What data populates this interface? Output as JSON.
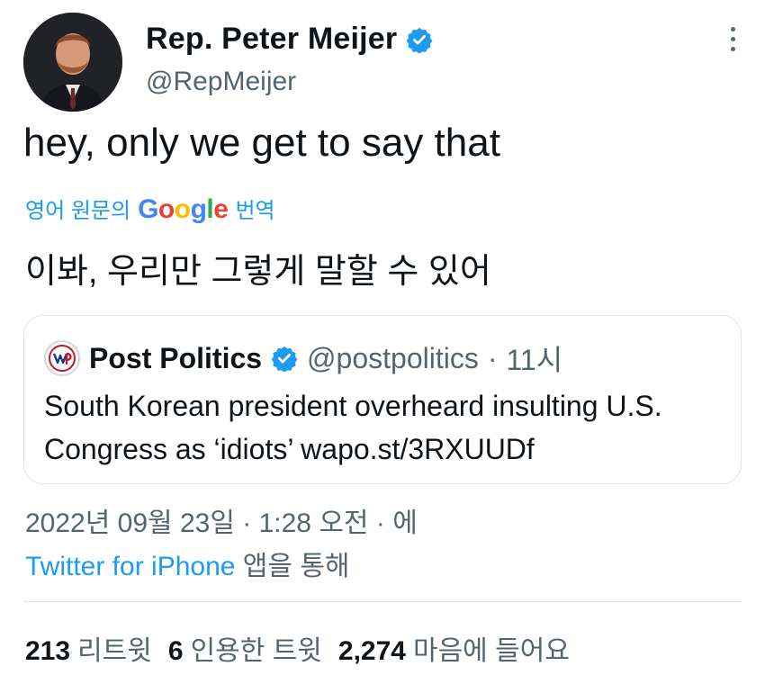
{
  "tweet": {
    "display_name": "Rep. Peter Meijer",
    "handle": "@RepMeijer",
    "text": "hey, only we get to say that",
    "translation_prefix": "영어 원문의",
    "translation_brand": "Google",
    "translation_suffix": "번역",
    "translated_text": "이봐, 우리만 그렇게 말할 수 있어"
  },
  "quote": {
    "name": "Post Politics",
    "handle": "@postpolitics",
    "separator": "·",
    "time": "11시",
    "text": "South Korean president overheard insulting U.S. Congress as ‘idiots’ wapo.st/3RXUUDf"
  },
  "meta": {
    "timestamp": "2022년 09월 23일 · 1:28 오전 · 에",
    "source_app": "Twitter for iPhone",
    "source_suffix": "앱을 통해"
  },
  "stats": [
    {
      "count": "213",
      "label": "리트윗"
    },
    {
      "count": "6",
      "label": "인용한 트윗"
    },
    {
      "count": "2,274",
      "label": "마음에 들어요"
    }
  ],
  "colors": {
    "accent": "#1d9bf0",
    "secondary_text": "#536471",
    "border": "#dfe4e8"
  },
  "icons": [
    "verified-badge-icon",
    "more-options-icon",
    "wapo-logo-icon"
  ]
}
